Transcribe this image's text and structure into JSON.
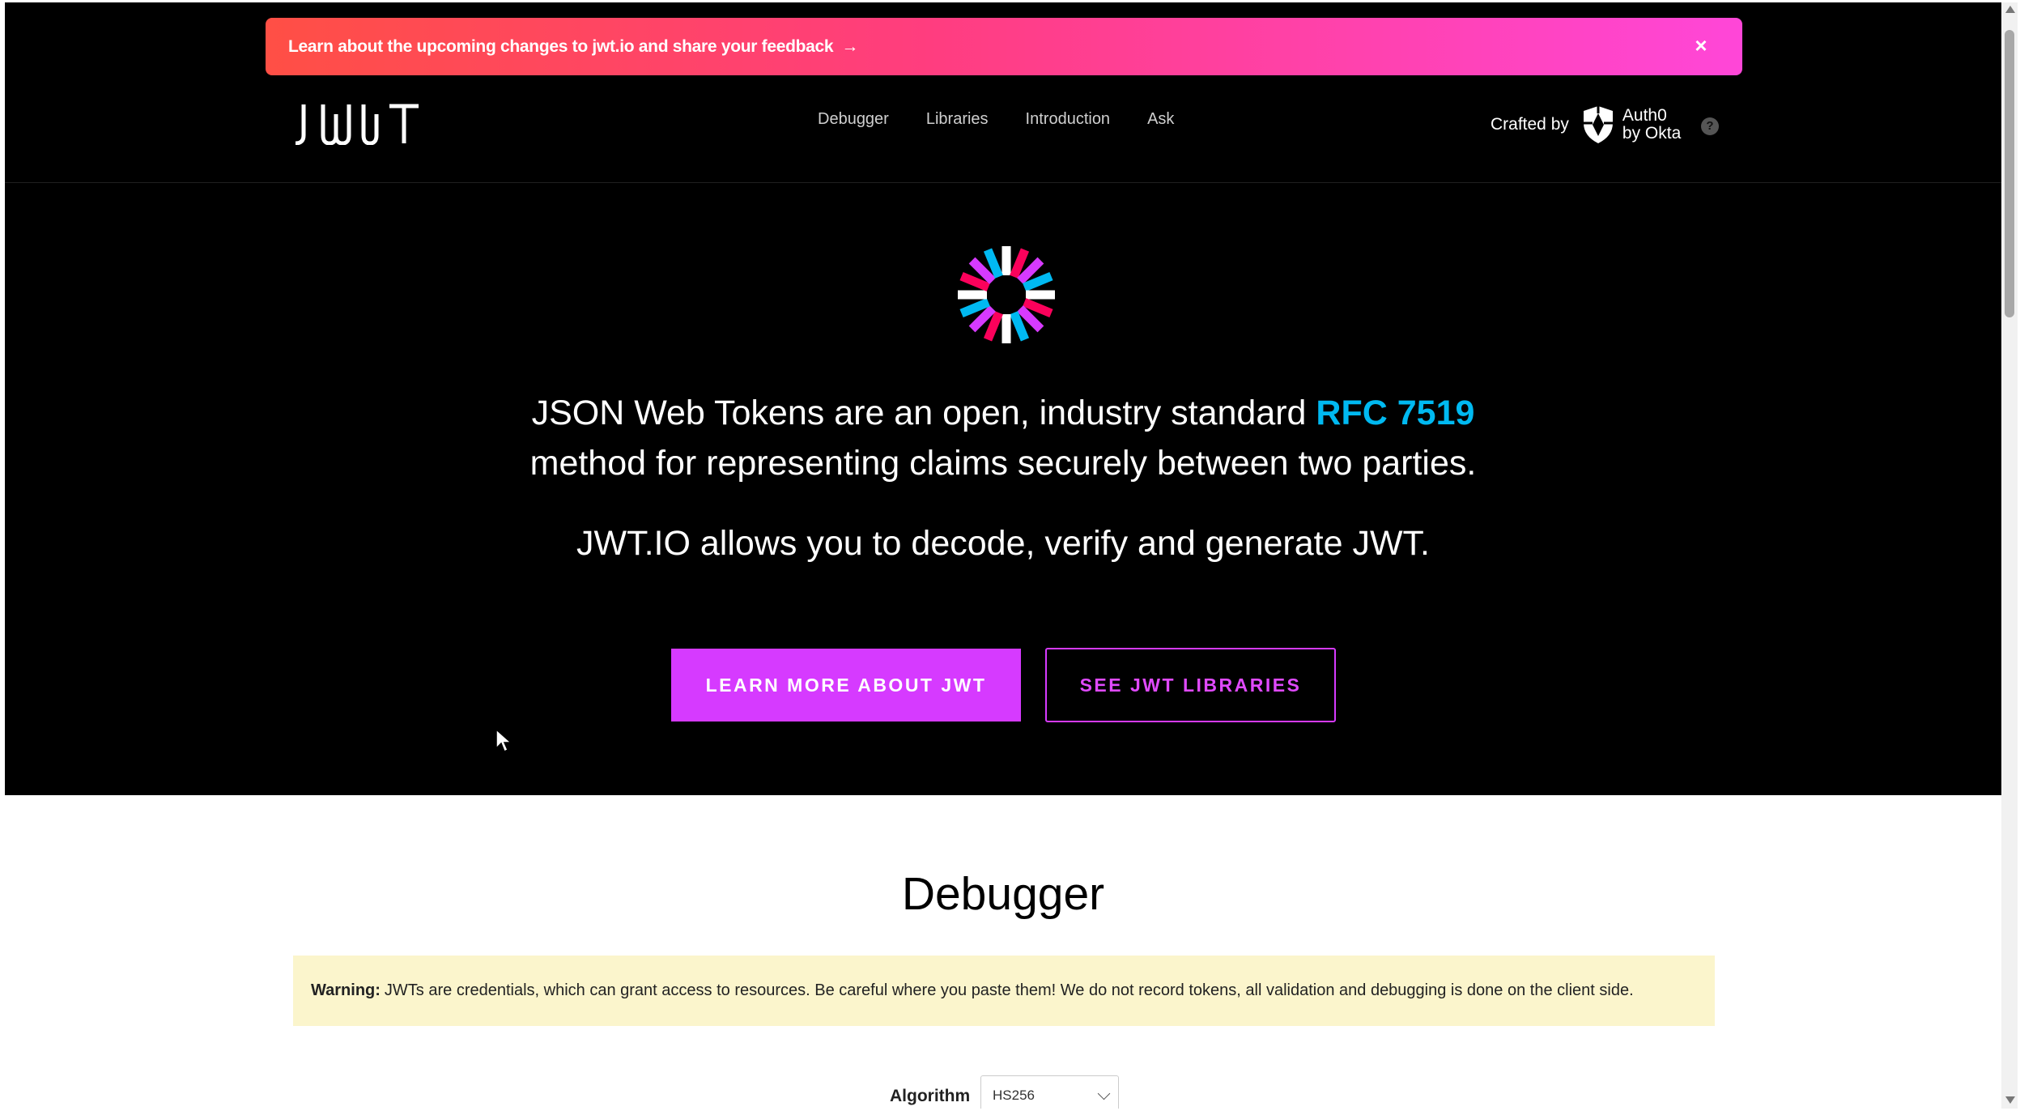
{
  "banner": {
    "text": "Learn about the upcoming changes to jwt.io and share your feedback",
    "arrow": "→",
    "close": "×"
  },
  "header": {
    "logo_text": "JWT",
    "nav": [
      "Debugger",
      "Libraries",
      "Introduction",
      "Ask"
    ],
    "crafted_by": "Crafted by",
    "auth0_line1": "Auth0",
    "auth0_line2": "by Okta",
    "help": "?"
  },
  "hero": {
    "line1_before": "JSON Web Tokens are an open, industry standard ",
    "rfc_link": "RFC 7519",
    "line1_after": " method for representing claims securely between two parties.",
    "line2": "JWT.IO allows you to decode, verify and generate JWT.",
    "learn_button": "LEARN MORE ABOUT JWT",
    "libraries_button": "SEE JWT LIBRARIES"
  },
  "debugger": {
    "title": "Debugger",
    "warning_label": "Warning:",
    "warning_text": "JWTs are credentials, which can grant access to resources. Be careful where you paste them! We do not record tokens, all validation and debugging is done on the client side.",
    "algorithm_label": "Algorithm",
    "algorithm_value": "HS256"
  },
  "colors": {
    "accent": "#d63aff",
    "rfc_link": "#00b9f1",
    "warning_bg": "#fbf5cc",
    "banner_start": "#ff4f45",
    "banner_end": "#ff46d8"
  },
  "icons": {
    "banner_arrow": "arrow-right-icon",
    "banner_close": "close-icon",
    "auth0_logo": "auth0-shield-icon",
    "help": "help-circle-icon",
    "hero_logo": "jwt-pinwheel-logo",
    "cursor": "mouse-pointer-icon",
    "select_chevron": "chevron-down-icon"
  }
}
